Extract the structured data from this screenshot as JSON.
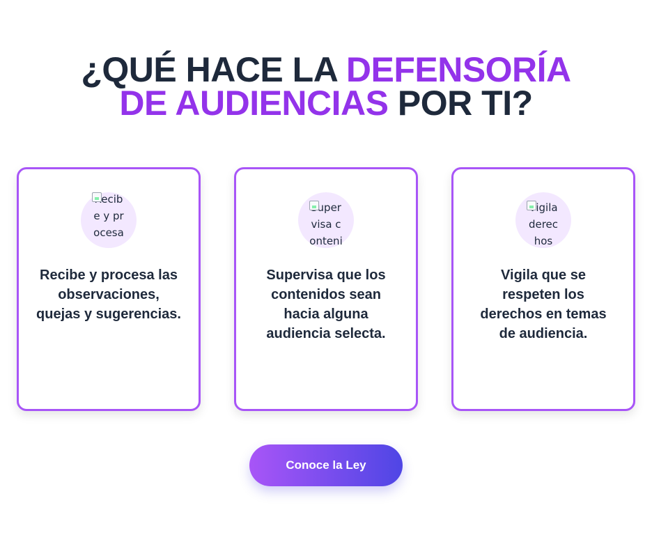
{
  "heading": {
    "part1": "¿QUÉ HACE LA ",
    "accent1": "DEFENSORÍA",
    "accent2": "DE AUDIENCIAS",
    "part2": " POR TI?"
  },
  "colors": {
    "accent": "#9333ea",
    "card_border": "#a855f7",
    "text": "#1e293b",
    "icon_bg": "#f3e8ff",
    "button_gradient_start": "#a855f7",
    "button_gradient_end": "#4f46e5"
  },
  "cards": [
    {
      "icon_alt": "Recibe y procesa",
      "text": "Recibe y procesa las observaciones, quejas y sugerencias."
    },
    {
      "icon_alt": "Supervisa contenidos",
      "text": "Supervisa que los contenidos sean hacia alguna audiencia selecta."
    },
    {
      "icon_alt": "Vigila derechos",
      "text": "Vigila que se respeten los derechos en temas de audiencia."
    }
  ],
  "cta": {
    "label": "Conoce la Ley"
  }
}
